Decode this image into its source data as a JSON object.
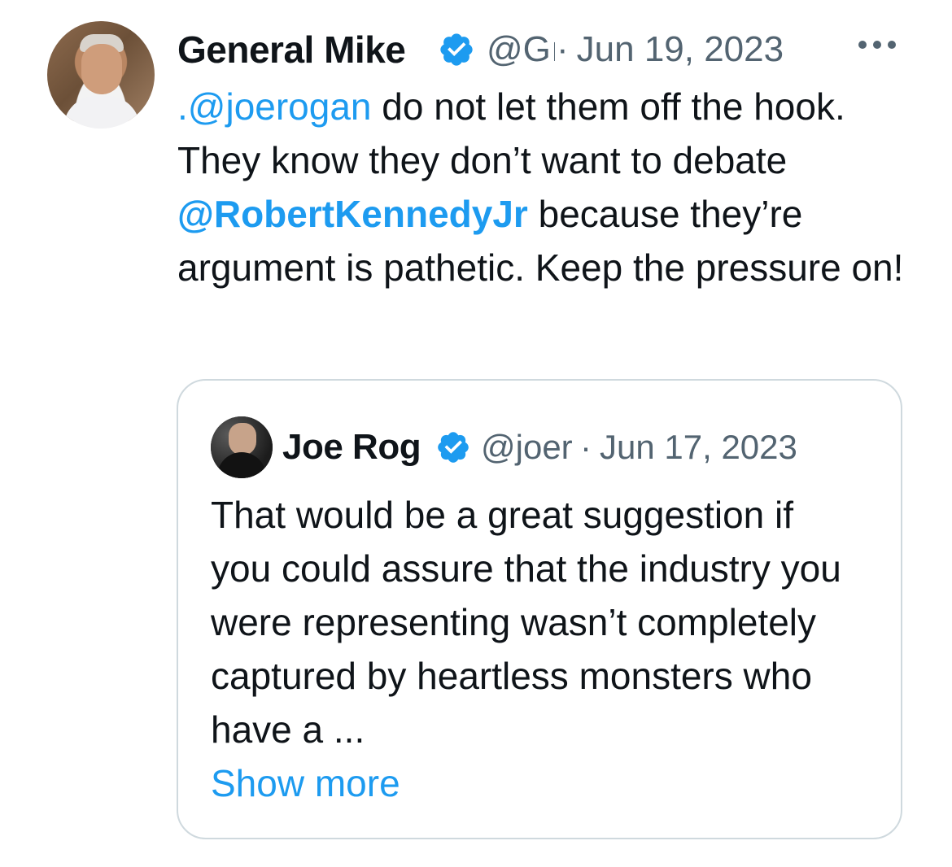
{
  "tweet": {
    "author": {
      "display_name": "General Mike",
      "handle": "@Gı",
      "verified_icon": "verified-badge-icon"
    },
    "separator": "·",
    "date": "Jun 19, 2023",
    "more_icon": "more-horizontal-icon",
    "text": {
      "mention1": ".@joerogan",
      "part1": " do not let them off the hook. They know they don’t want to debate ",
      "mention2": "@RobertKennedyJr",
      "part2": " because they’re argument is pathetic. Keep the pressure on!"
    }
  },
  "quote": {
    "author": {
      "display_name": "Joe Rog",
      "handle": "@joer",
      "verified_icon": "verified-badge-icon"
    },
    "separator": "·",
    "date": "Jun 17, 2023",
    "text": "That would be a great suggestion if you could assure that the industry you were representing wasn’t completely captured by heartless monsters who have a ...",
    "show_more_label": "Show more"
  },
  "colors": {
    "accent": "#1d9bf0",
    "secondary_text": "#536471",
    "primary_text": "#0f1419",
    "border": "#cfd9de"
  }
}
